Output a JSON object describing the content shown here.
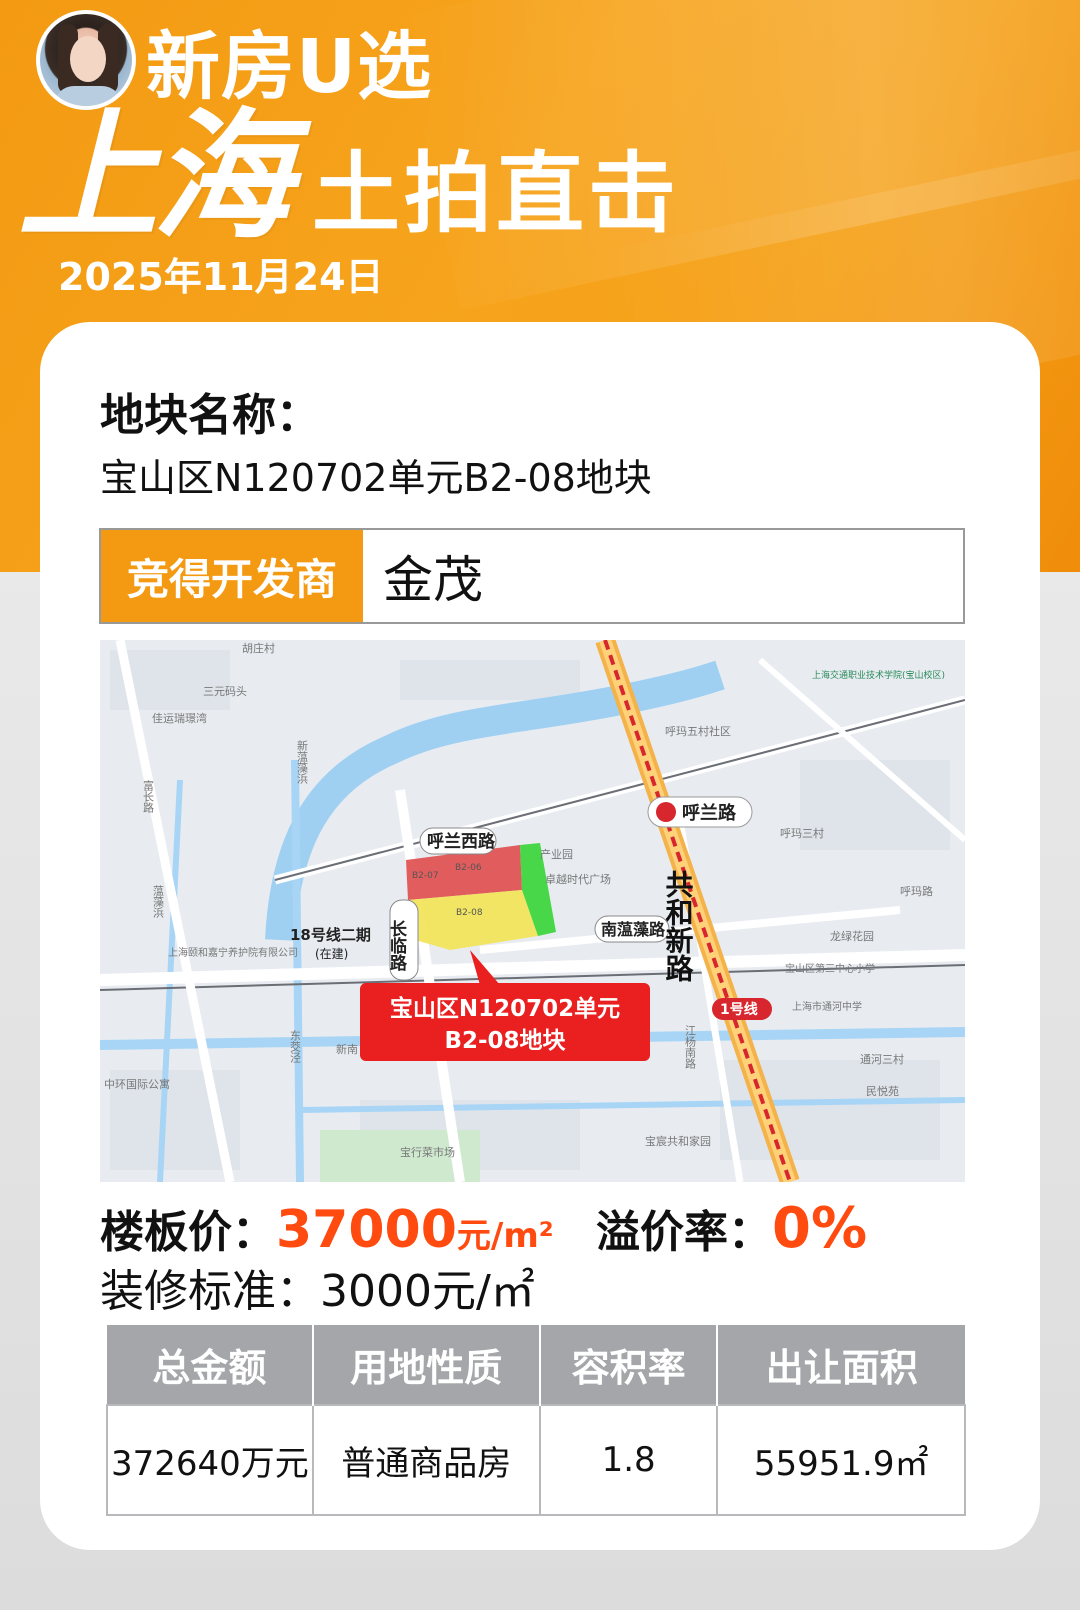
{
  "header": {
    "brand": "新房U选",
    "city": "上海",
    "subtitle": "土拍直击",
    "date": "2025年11月24日"
  },
  "plot": {
    "name_label": "地块名称：",
    "name_value": "宝山区N120702单元B2-08地块",
    "developer_label": "竞得开发商",
    "developer_value": "金茂"
  },
  "map": {
    "callout_line1": "宝山区N120702单元",
    "callout_line2": "B2-08地块",
    "roads": [
      "呼兰西路",
      "长临路",
      "南蕰藻路",
      "共和新路",
      "呼兰路"
    ],
    "metro": [
      "1号线",
      "18号线二期",
      "(在建)"
    ],
    "places": [
      "胡庄村",
      "三元码头",
      "佳运瑞璟湾",
      "富长路",
      "蕰藻浜",
      "上海颐和嘉宁养护院有限公司",
      "中环国际公寓",
      "新南",
      "东茭泾",
      "宝宸共和家园",
      "上海交通职业技术学院(宝山校区)",
      "呼玛五村社区",
      "呼玛三村",
      "龙绿花园",
      "宝山区第三中心小学",
      "上海市通河中学",
      "通河三村",
      "民悦苑",
      "卓越时代广场",
      "产业园",
      "呼玛路",
      "宝行菜市场",
      "新蕰藻浜",
      "江杨南路"
    ],
    "parcels": [
      "B2-07",
      "B2-06",
      "B2-08"
    ],
    "parcel_colors": {
      "red": "#e05050",
      "yellow": "#f2e55c",
      "green": "#3ed63e"
    }
  },
  "pricing": {
    "floor_price_label": "楼板价：",
    "floor_price_value": "37000",
    "floor_price_unit": "元/m²",
    "premium_label": "溢价率：",
    "premium_value": "0%",
    "decoration": "装修标准：3000元/㎡"
  },
  "table": {
    "headers": [
      "总金额",
      "用地性质",
      "容积率",
      "出让面积"
    ],
    "row": [
      "372640万元",
      "普通商品房",
      "1.8",
      "55951.9㎡"
    ]
  },
  "colors": {
    "accent": "#f39a12",
    "highlight": "#ff4a10",
    "header_gray": "#a4a6a9"
  }
}
